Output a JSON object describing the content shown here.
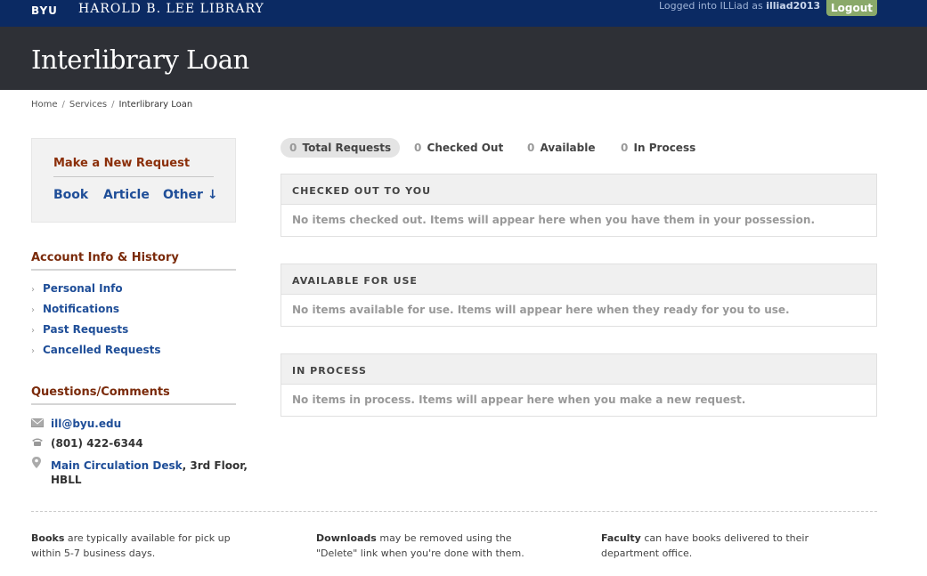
{
  "header": {
    "brand": "BYU",
    "library": "HAROLD B. LEE LIBRARY",
    "logged_prefix": "Logged into ILLiad as",
    "username": "illiad2013",
    "logout_label": "Logout"
  },
  "page_title": "Interlibrary Loan",
  "breadcrumb": {
    "home": "Home",
    "services": "Services",
    "current": "Interlibrary Loan",
    "separator": "/"
  },
  "new_request": {
    "title": "Make a New Request",
    "book": "Book",
    "article": "Article",
    "other": "Other ↓"
  },
  "account": {
    "title": "Account Info & History",
    "items": [
      "Personal Info",
      "Notifications",
      "Past Requests",
      "Cancelled Requests"
    ]
  },
  "questions": {
    "title": "Questions/Comments",
    "email": "ill@byu.edu",
    "phone": "(801) 422-6344",
    "location_link": "Main Circulation Desk",
    "location_rest": ", 3rd Floor,",
    "location_line2": "HBLL"
  },
  "status": {
    "total_count": "0",
    "total_label": "Total Requests",
    "checked_count": "0",
    "checked_label": "Checked Out",
    "available_count": "0",
    "available_label": "Available",
    "process_count": "0",
    "process_label": "In Process"
  },
  "panels": {
    "checked_out": {
      "title": "CHECKED OUT TO YOU",
      "message": "No items checked out. Items will appear here when you have them in your possession."
    },
    "available": {
      "title": "AVAILABLE FOR USE",
      "message": "No items available for use. Items will appear here when they ready for you to use."
    },
    "in_process": {
      "title": "IN PROCESS",
      "message": "No items in process. Items will appear here when you make a new request."
    }
  },
  "footer": {
    "col1_bold": "Books",
    "col1_text": " are typically available for pick up within 5-7 business days.",
    "col2_bold": "Downloads",
    "col2_text": " may be removed using the \"Delete\" link when you're done with them.",
    "col3_bold": "Faculty",
    "col3_text": " can have books delivered to their department office."
  },
  "icons": {
    "email": "envelope-icon",
    "phone": "phone-icon",
    "location": "map-pin-icon",
    "chevron": "chevron-right-icon"
  },
  "colors": {
    "header_bg": "#0b2a63",
    "title_bg": "#2e3036",
    "logout_bg": "#8aa96a",
    "section_heading": "#7a2a0a",
    "link": "#1f4e98"
  }
}
